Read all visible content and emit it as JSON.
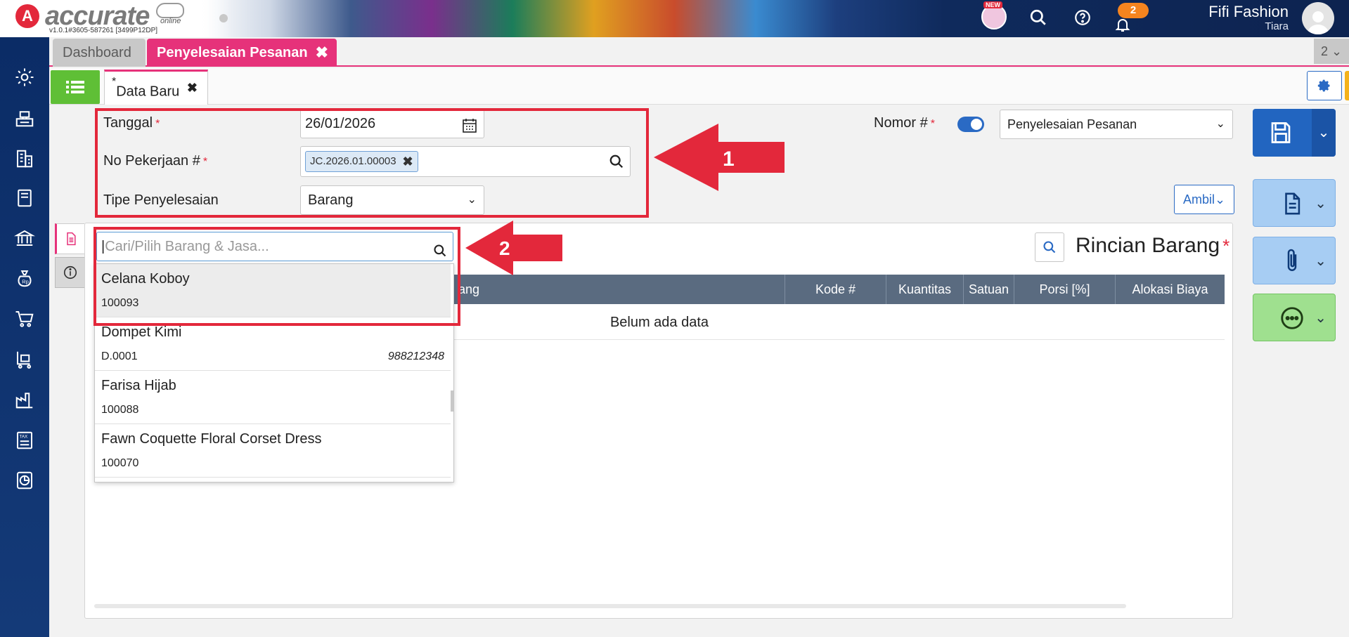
{
  "header": {
    "logo_mark": "A",
    "logo_text": "accurate",
    "logo_sub": "online",
    "version": "v1.0.1#3605-587261 [3499P12DP]",
    "new_badge": "NEW",
    "notif_count": "2",
    "user_name": "Fifi Fashion",
    "user_sub": "Tiara"
  },
  "tabs": {
    "dashboard": "Dashboard",
    "active": "Penyelesaian Pesanan",
    "close": "✖",
    "count": "2 ⌄"
  },
  "subtabs": {
    "mark": "*",
    "label": "Data Baru",
    "close": "✖"
  },
  "form": {
    "tanggal_label": "Tanggal",
    "tanggal_value": "26/01/2026",
    "no_pekerjaan_label": "No Pekerjaan #",
    "no_pekerjaan_chip": "JC.2026.01.00003",
    "tipe_label": "Tipe Penyelesaian",
    "tipe_value": "Barang",
    "nomor_label": "Nomor #",
    "nomor_select": "Penyelesaian Pesanan",
    "required_mark": "*",
    "ambil_label": "Ambil"
  },
  "annotations": {
    "arrow1": "1",
    "arrow2": "2"
  },
  "detail": {
    "title": "Rincian Barang",
    "columns": [
      "ang",
      "Kode #",
      "Kuantitas",
      "Satuan",
      "Porsi [%]",
      "Alokasi Biaya"
    ],
    "empty_text": "Belum ada data"
  },
  "dropdown": {
    "placeholder": "Cari/Pilih Barang & Jasa...",
    "items": [
      {
        "name": "Celana Koboy",
        "code": "100093",
        "barcode": ""
      },
      {
        "name": "Dompet Kimi",
        "code": "D.0001",
        "barcode": "988212348"
      },
      {
        "name": "Farisa Hijab",
        "code": "100088",
        "barcode": ""
      },
      {
        "name": "Fawn Coquette Floral Corset Dress",
        "code": "100070",
        "barcode": ""
      }
    ]
  },
  "colors": {
    "brand_red": "#e3283b",
    "active_tab": "#e6327a",
    "primary_blue": "#2265c0",
    "green": "#5fbf36"
  }
}
